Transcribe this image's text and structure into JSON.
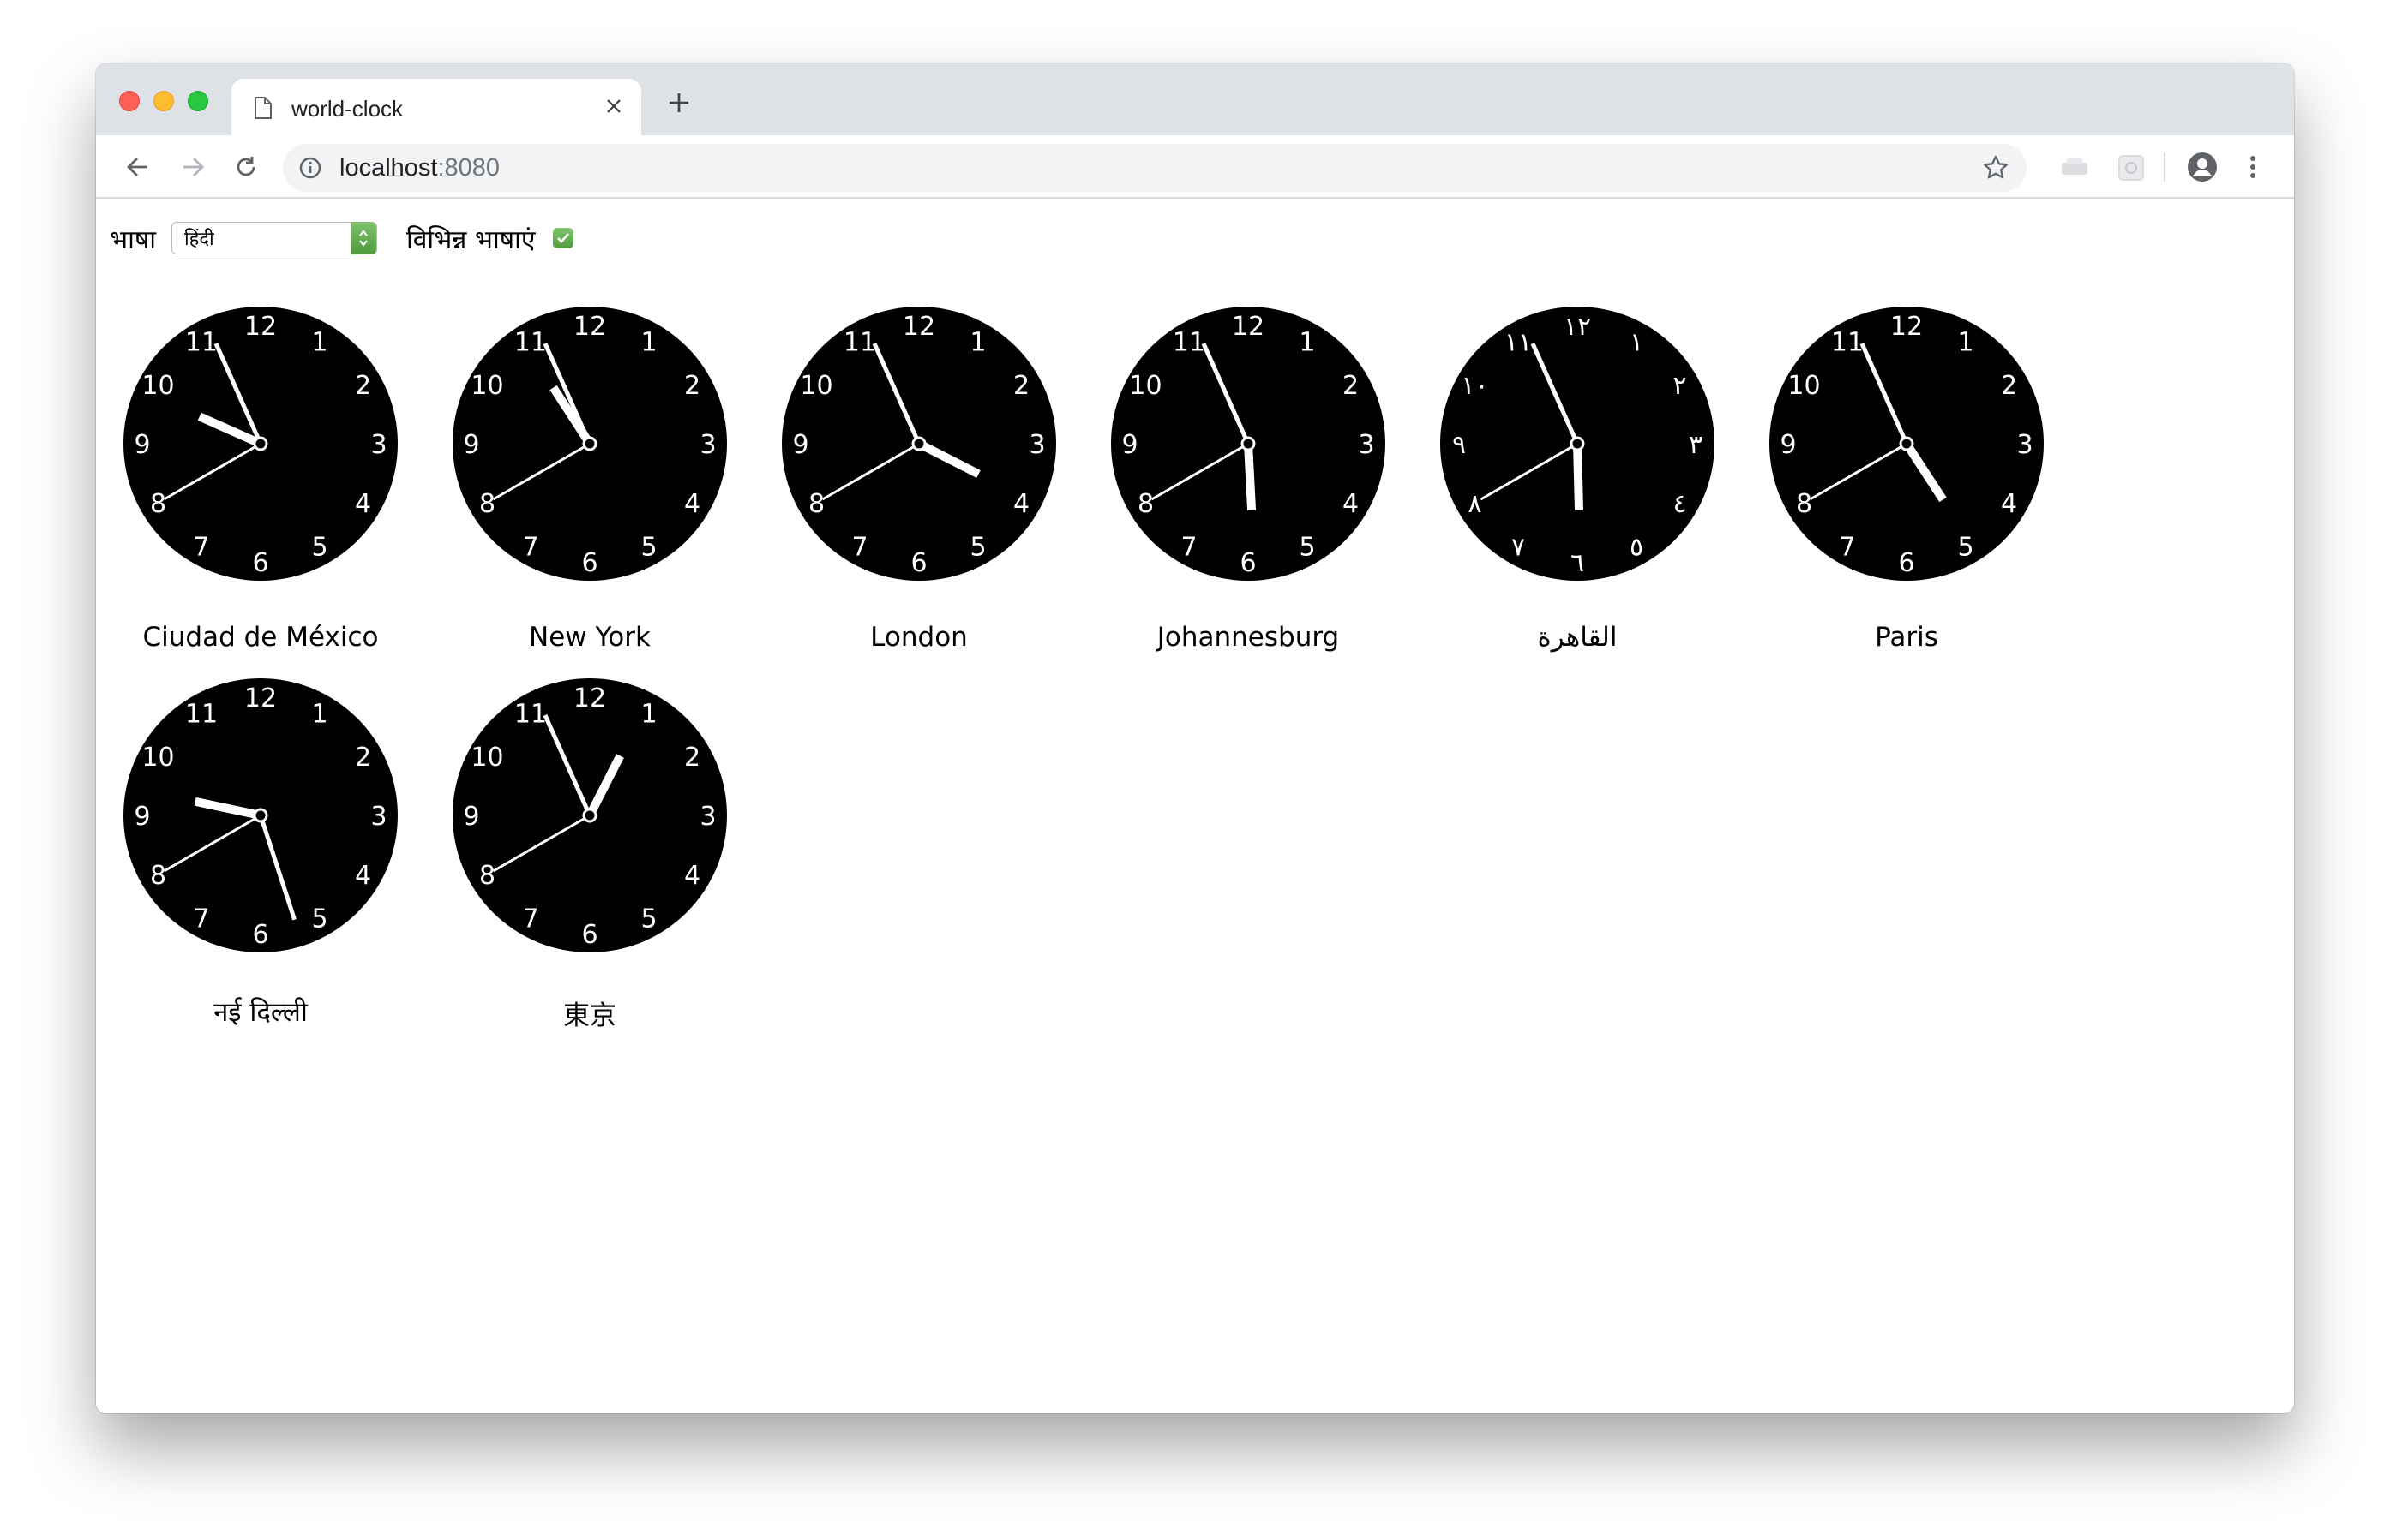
{
  "browser": {
    "tab_title": "world-clock",
    "url_host": "localhost",
    "url_port": ":8080"
  },
  "controls": {
    "language_label": "भाषा",
    "language_value": "हिंदी",
    "multi_language_label": "विभिन्न भाषाएं",
    "multi_language_checked": true
  },
  "clocks": [
    {
      "name": "Ciudad de México",
      "hour": 9.8,
      "minute": 56,
      "second": 40,
      "numerals": [
        "12",
        "1",
        "2",
        "3",
        "4",
        "5",
        "6",
        "7",
        "8",
        "9",
        "10",
        "11"
      ]
    },
    {
      "name": "New York",
      "hour": 10.9,
      "minute": 56,
      "second": 40,
      "numerals": [
        "12",
        "1",
        "2",
        "3",
        "4",
        "5",
        "6",
        "7",
        "8",
        "9",
        "10",
        "11"
      ]
    },
    {
      "name": "London",
      "hour": 3.9,
      "minute": 56,
      "second": 40,
      "numerals": [
        "12",
        "1",
        "2",
        "3",
        "4",
        "5",
        "6",
        "7",
        "8",
        "9",
        "10",
        "11"
      ]
    },
    {
      "name": "Johannesburg",
      "hour": 5.9,
      "minute": 56,
      "second": 40,
      "numerals": [
        "12",
        "1",
        "2",
        "3",
        "4",
        "5",
        "6",
        "7",
        "8",
        "9",
        "10",
        "11"
      ]
    },
    {
      "name": "القاهرة",
      "hour": 5.95,
      "minute": 56,
      "second": 40,
      "numerals": [
        "١٢",
        "١",
        "٢",
        "٣",
        "٤",
        "٥",
        "٦",
        "٧",
        "٨",
        "٩",
        "١٠",
        "١١"
      ]
    },
    {
      "name": "Paris",
      "hour": 4.9,
      "minute": 56,
      "second": 40,
      "numerals": [
        "12",
        "1",
        "2",
        "3",
        "4",
        "5",
        "6",
        "7",
        "8",
        "9",
        "10",
        "11"
      ]
    },
    {
      "name": "नई दिल्ली",
      "hour": 9.4,
      "minute": 27,
      "second": 40,
      "numerals": [
        "12",
        "1",
        "2",
        "3",
        "4",
        "5",
        "6",
        "7",
        "8",
        "9",
        "10",
        "11"
      ]
    },
    {
      "name": "東京",
      "hour": 0.9,
      "minute": 56,
      "second": 40,
      "numerals": [
        "12",
        "1",
        "2",
        "3",
        "4",
        "5",
        "6",
        "7",
        "8",
        "9",
        "10",
        "11"
      ]
    }
  ]
}
